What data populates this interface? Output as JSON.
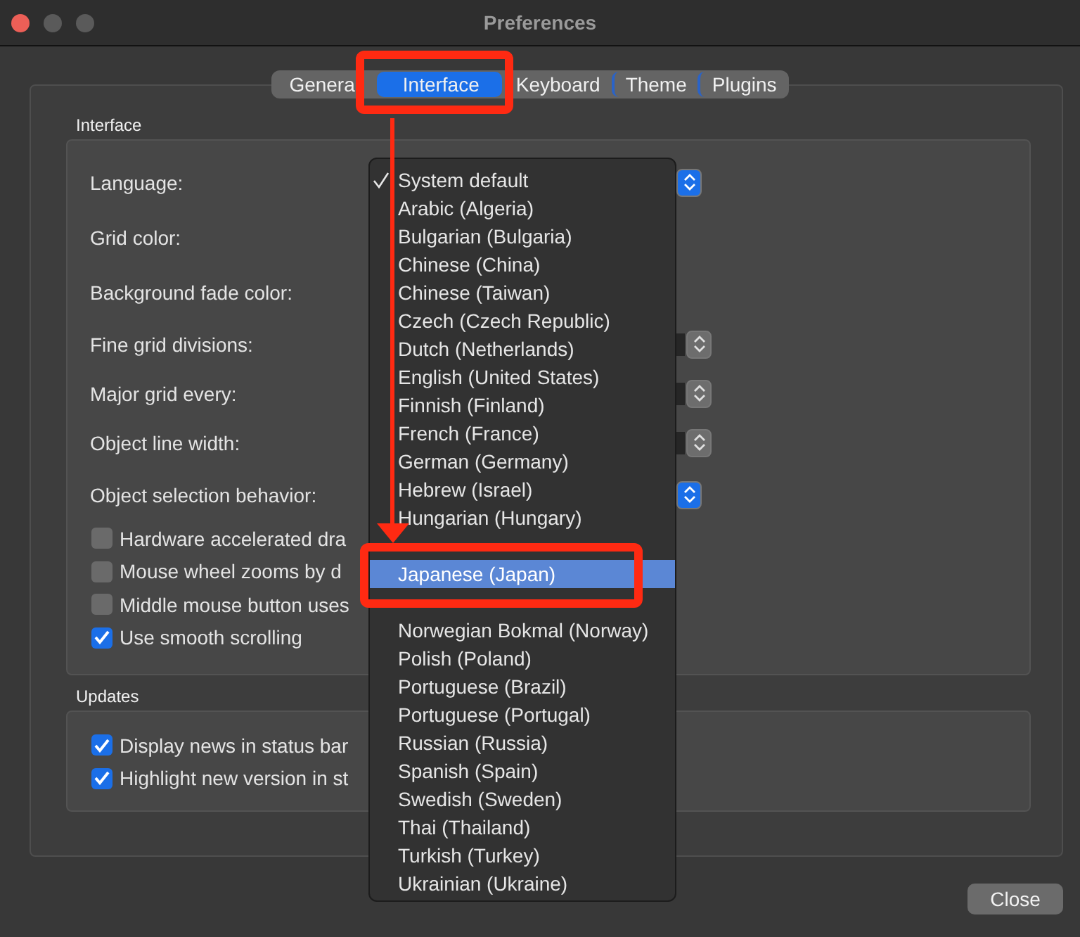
{
  "window": {
    "title": "Preferences"
  },
  "tabs": [
    {
      "label": "Genera",
      "selected": false
    },
    {
      "label": "Interface",
      "selected": true
    },
    {
      "label": "Keyboard",
      "selected": false
    },
    {
      "label": "Theme",
      "selected": false
    },
    {
      "label": "Plugins",
      "selected": false
    }
  ],
  "interface": {
    "title": "Interface",
    "rows": [
      {
        "label": "Language:",
        "kind": "select"
      },
      {
        "label": "Grid color:",
        "kind": "color"
      },
      {
        "label": "Background fade color:",
        "kind": "color"
      },
      {
        "label": "Fine grid divisions:",
        "kind": "spin"
      },
      {
        "label": "Major grid every:",
        "kind": "spin"
      },
      {
        "label": "Object line width:",
        "kind": "spin"
      },
      {
        "label": "Object selection behavior:",
        "kind": "select"
      }
    ],
    "checkboxes": [
      {
        "label": "Hardware accelerated dra",
        "checked": false
      },
      {
        "label": "Mouse wheel zooms by d",
        "checked": false
      },
      {
        "label": "Middle mouse button uses",
        "checked": false
      },
      {
        "label": "Use smooth scrolling",
        "checked": true
      }
    ]
  },
  "updates": {
    "title": "Updates",
    "checkboxes": [
      {
        "label": "Display news in status bar",
        "checked": true
      },
      {
        "label": "Highlight new version in st",
        "checked": true
      }
    ]
  },
  "language_menu": [
    {
      "label": "System default",
      "checked": true,
      "selected": false
    },
    {
      "label": "Arabic (Algeria)",
      "checked": false,
      "selected": false
    },
    {
      "label": "Bulgarian (Bulgaria)",
      "checked": false,
      "selected": false
    },
    {
      "label": "Chinese (China)",
      "checked": false,
      "selected": false
    },
    {
      "label": "Chinese (Taiwan)",
      "checked": false,
      "selected": false
    },
    {
      "label": "Czech (Czech Republic)",
      "checked": false,
      "selected": false
    },
    {
      "label": "Dutch (Netherlands)",
      "checked": false,
      "selected": false
    },
    {
      "label": "English (United States)",
      "checked": false,
      "selected": false
    },
    {
      "label": "Finnish (Finland)",
      "checked": false,
      "selected": false
    },
    {
      "label": "French (France)",
      "checked": false,
      "selected": false
    },
    {
      "label": "German (Germany)",
      "checked": false,
      "selected": false
    },
    {
      "label": "Hebrew (Israel)",
      "checked": false,
      "selected": false
    },
    {
      "label": "Hungarian (Hungary)",
      "checked": false,
      "selected": false
    },
    {
      "label": "Japanese (Japan)",
      "checked": false,
      "selected": true
    },
    {
      "label": "Norwegian Bokmal (Norway)",
      "checked": false,
      "selected": false
    },
    {
      "label": "Polish (Poland)",
      "checked": false,
      "selected": false
    },
    {
      "label": "Portuguese (Brazil)",
      "checked": false,
      "selected": false
    },
    {
      "label": "Portuguese (Portugal)",
      "checked": false,
      "selected": false
    },
    {
      "label": "Russian (Russia)",
      "checked": false,
      "selected": false
    },
    {
      "label": "Spanish (Spain)",
      "checked": false,
      "selected": false
    },
    {
      "label": "Swedish (Sweden)",
      "checked": false,
      "selected": false
    },
    {
      "label": "Thai (Thailand)",
      "checked": false,
      "selected": false
    },
    {
      "label": "Turkish (Turkey)",
      "checked": false,
      "selected": false
    },
    {
      "label": "Ukrainian (Ukraine)",
      "checked": false,
      "selected": false
    }
  ],
  "close_button": {
    "label": "Close"
  }
}
